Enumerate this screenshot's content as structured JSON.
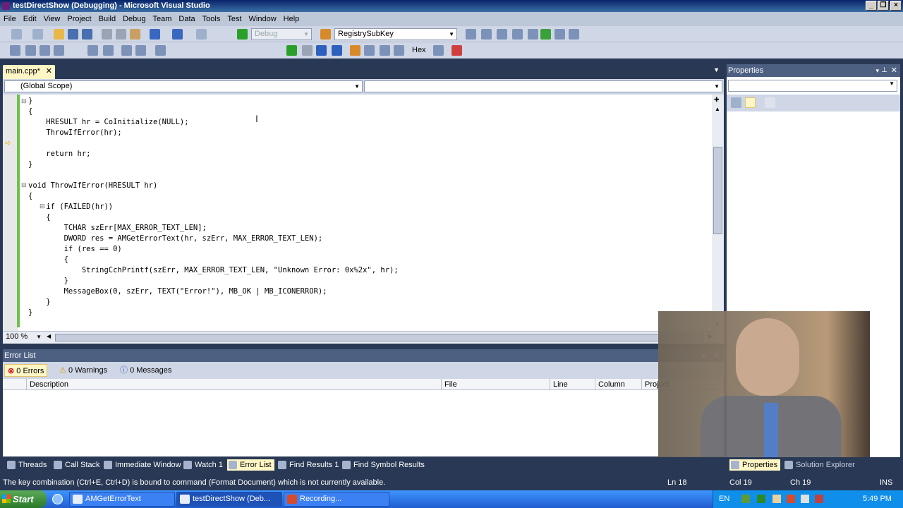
{
  "window": {
    "title": "testDirectShow (Debugging) - Microsoft Visual Studio"
  },
  "menu": [
    "File",
    "Edit",
    "View",
    "Project",
    "Build",
    "Debug",
    "Team",
    "Data",
    "Tools",
    "Test",
    "Window",
    "Help"
  ],
  "toolbar": {
    "config": "Debug",
    "search_combo": "RegistrySubKey",
    "hex_label": "Hex"
  },
  "editor": {
    "tab_label": "main.cpp*",
    "scope": "(Global Scope)",
    "zoom": "100 %",
    "lines": [
      "}",
      "{",
      "    HRESULT hr = CoInitialize(NULL);",
      "    ThrowIfError(hr);",
      "",
      "    return hr;",
      "}",
      "",
      "void ThrowIfError(HRESULT hr)",
      "{",
      "    if (FAILED(hr))",
      "    {",
      "        TCHAR szErr[MAX_ERROR_TEXT_LEN];",
      "        DWORD res = AMGetErrorText(hr, szErr, MAX_ERROR_TEXT_LEN);",
      "        if (res == 0)",
      "        {",
      "            StringCchPrintf(szErr, MAX_ERROR_TEXT_LEN, \"Unknown Error: 0x%2x\", hr);",
      "        }",
      "        MessageBox(0, szErr, TEXT(\"Error!\"), MB_OK | MB_ICONERROR);",
      "    }",
      "}"
    ]
  },
  "error_list": {
    "title": "Error List",
    "errors": "0 Errors",
    "warnings": "0 Warnings",
    "messages": "0 Messages",
    "columns": [
      "Description",
      "File",
      "Line",
      "Column",
      "Project"
    ]
  },
  "properties": {
    "title": "Properties",
    "tab_properties": "Properties",
    "tab_solution": "Solution Explorer"
  },
  "bottom_tabs": [
    "Threads",
    "Call Stack",
    "Immediate Window",
    "Watch 1",
    "Error List",
    "Find Results 1",
    "Find Symbol Results"
  ],
  "status": {
    "message": "The key combination (Ctrl+E, Ctrl+D) is bound to command (Format Document) which is not currently available.",
    "ln": "Ln 18",
    "col": "Col 19",
    "ch": "Ch 19",
    "mode": "INS"
  },
  "taskbar": {
    "start": "Start",
    "tasks": [
      "AMGetErrorText function...",
      "testDirectShow (Deb...",
      "Recording..."
    ],
    "lang": "EN",
    "time": "5:49 PM"
  }
}
